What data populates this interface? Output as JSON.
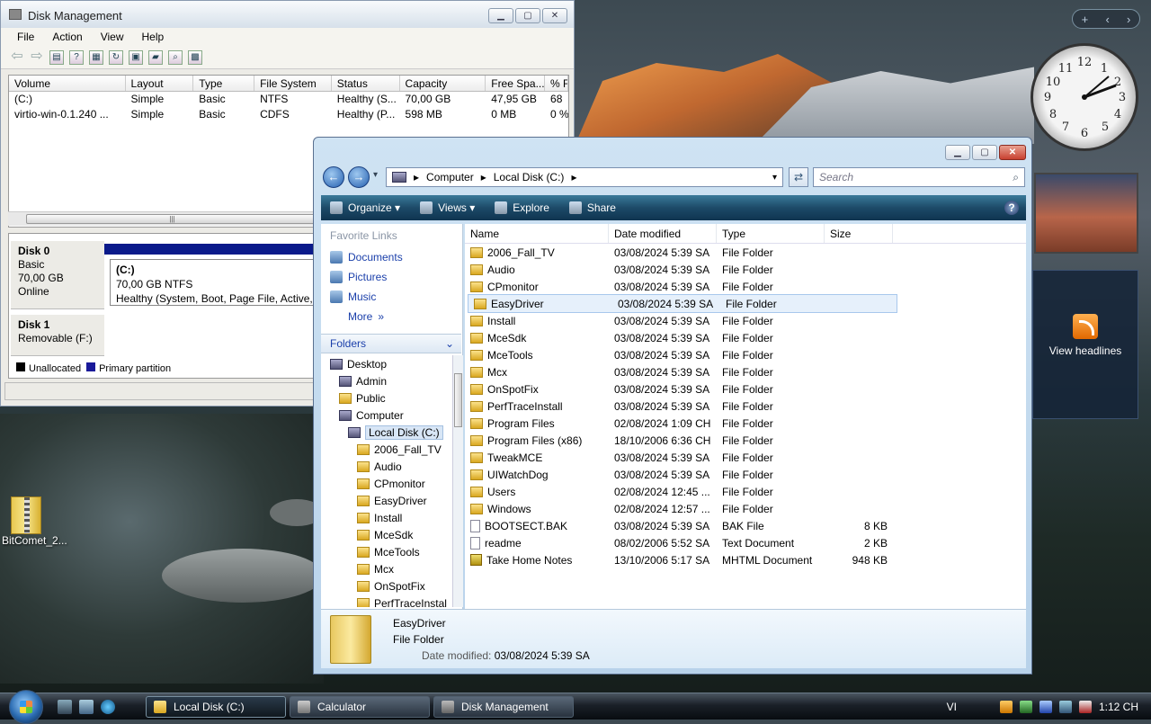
{
  "disk_management": {
    "title": "Disk Management",
    "menu": [
      "File",
      "Action",
      "View",
      "Help"
    ],
    "columns": [
      "Volume",
      "Layout",
      "Type",
      "File System",
      "Status",
      "Capacity",
      "Free Spa...",
      "% F"
    ],
    "volumes": [
      [
        "(C:)",
        "Simple",
        "Basic",
        "NTFS",
        "Healthy (S...",
        "70,00 GB",
        "47,95 GB",
        "68"
      ],
      [
        "virtio-win-0.1.240 ...",
        "Simple",
        "Basic",
        "CDFS",
        "Healthy (P...",
        "598 MB",
        "0 MB",
        "0 %"
      ]
    ],
    "disk0": {
      "name": "Disk 0",
      "type": "Basic",
      "size": "70,00 GB",
      "state": "Online",
      "part_name": "(C:)",
      "part_size": "70,00 GB NTFS",
      "part_status": "Healthy (System, Boot, Page File, Active, Cr"
    },
    "disk1": {
      "name": "Disk 1",
      "type": "Removable (F:)"
    },
    "legend": [
      "Unallocated",
      "Primary partition"
    ]
  },
  "explorer": {
    "breadcrumb": [
      "Computer",
      "Local Disk (C:)"
    ],
    "search_placeholder": "Search",
    "commands": [
      "Organize",
      "Views",
      "Explore",
      "Share"
    ],
    "favorites_title": "Favorite Links",
    "favorites": [
      "Documents",
      "Pictures",
      "Music",
      "More"
    ],
    "folders_title": "Folders",
    "tree": [
      "Desktop",
      "Admin",
      "Public",
      "Computer",
      "Local Disk (C:)",
      "2006_Fall_TV",
      "Audio",
      "CPmonitor",
      "EasyDriver",
      "Install",
      "MceSdk",
      "MceTools",
      "Mcx",
      "OnSpotFix",
      "PerfTraceInstal"
    ],
    "columns": [
      "Name",
      "Date modified",
      "Type",
      "Size"
    ],
    "files": [
      {
        "name": "2006_Fall_TV",
        "date": "03/08/2024 5:39 SA",
        "type": "File Folder",
        "size": "",
        "kind": "folder"
      },
      {
        "name": "Audio",
        "date": "03/08/2024 5:39 SA",
        "type": "File Folder",
        "size": "",
        "kind": "folder"
      },
      {
        "name": "CPmonitor",
        "date": "03/08/2024 5:39 SA",
        "type": "File Folder",
        "size": "",
        "kind": "folder"
      },
      {
        "name": "EasyDriver",
        "date": "03/08/2024 5:39 SA",
        "type": "File Folder",
        "size": "",
        "kind": "folder",
        "selected": true
      },
      {
        "name": "Install",
        "date": "03/08/2024 5:39 SA",
        "type": "File Folder",
        "size": "",
        "kind": "folder"
      },
      {
        "name": "MceSdk",
        "date": "03/08/2024 5:39 SA",
        "type": "File Folder",
        "size": "",
        "kind": "folder"
      },
      {
        "name": "MceTools",
        "date": "03/08/2024 5:39 SA",
        "type": "File Folder",
        "size": "",
        "kind": "folder"
      },
      {
        "name": "Mcx",
        "date": "03/08/2024 5:39 SA",
        "type": "File Folder",
        "size": "",
        "kind": "folder"
      },
      {
        "name": "OnSpotFix",
        "date": "03/08/2024 5:39 SA",
        "type": "File Folder",
        "size": "",
        "kind": "folder"
      },
      {
        "name": "PerfTraceInstall",
        "date": "03/08/2024 5:39 SA",
        "type": "File Folder",
        "size": "",
        "kind": "folder"
      },
      {
        "name": "Program Files",
        "date": "02/08/2024 1:09 CH",
        "type": "File Folder",
        "size": "",
        "kind": "folder"
      },
      {
        "name": "Program Files (x86)",
        "date": "18/10/2006 6:36 CH",
        "type": "File Folder",
        "size": "",
        "kind": "folder"
      },
      {
        "name": "TweakMCE",
        "date": "03/08/2024 5:39 SA",
        "type": "File Folder",
        "size": "",
        "kind": "folder"
      },
      {
        "name": "UIWatchDog",
        "date": "03/08/2024 5:39 SA",
        "type": "File Folder",
        "size": "",
        "kind": "folder"
      },
      {
        "name": "Users",
        "date": "02/08/2024 12:45 ...",
        "type": "File Folder",
        "size": "",
        "kind": "folder"
      },
      {
        "name": "Windows",
        "date": "02/08/2024 12:57 ...",
        "type": "File Folder",
        "size": "",
        "kind": "folder"
      },
      {
        "name": "BOOTSECT.BAK",
        "date": "03/08/2024 5:39 SA",
        "type": "BAK File",
        "size": "8 KB",
        "kind": "file"
      },
      {
        "name": "readme",
        "date": "08/02/2006 5:52 SA",
        "type": "Text Document",
        "size": "2 KB",
        "kind": "file"
      },
      {
        "name": "Take Home Notes",
        "date": "13/10/2006 5:17 SA",
        "type": "MHTML Document",
        "size": "948 KB",
        "kind": "mht"
      }
    ],
    "details": {
      "name": "EasyDriver",
      "type": "File Folder",
      "modified_label": "Date modified:",
      "modified": "03/08/2024 5:39 SA"
    }
  },
  "desktop": {
    "icon_label": "BitComet_2...",
    "feed_label": "View headlines"
  },
  "taskbar": {
    "buttons": [
      "Local Disk (C:)",
      "Calculator",
      "Disk Management"
    ],
    "lang": "VI",
    "time": "1:12 CH"
  }
}
